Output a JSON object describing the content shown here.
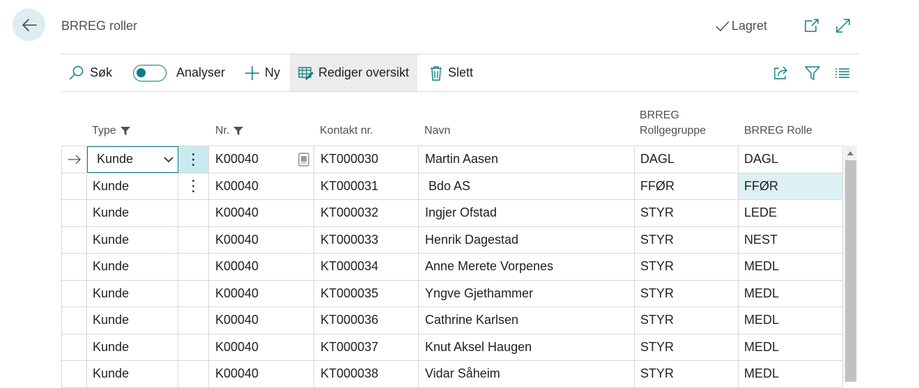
{
  "header": {
    "title": "BRREG roller",
    "saved_label": "Lagret"
  },
  "actions": {
    "search": "Søk",
    "analyze": "Analyser",
    "new": "Ny",
    "edit_list": "Rediger oversikt",
    "delete": "Slett"
  },
  "columns": {
    "type": "Type",
    "nr": "Nr.",
    "kontakt": "Kontakt nr.",
    "navn": "Navn",
    "grp_line1": "BRREG",
    "grp_line2": "Rollgegruppe",
    "rolle": "BRREG Rolle"
  },
  "rows": [
    {
      "type": "Kunde",
      "nr": "K00040",
      "kontakt": "KT000030",
      "navn": "Martin Aasen",
      "grp": "DAGL",
      "rolle": "DAGL"
    },
    {
      "type": "Kunde",
      "nr": "K00040",
      "kontakt": "KT000031",
      "navn": " Bdo AS",
      "grp": "FFØR",
      "rolle": "FFØR"
    },
    {
      "type": "Kunde",
      "nr": "K00040",
      "kontakt": "KT000032",
      "navn": "Ingjer Ofstad",
      "grp": "STYR",
      "rolle": "LEDE"
    },
    {
      "type": "Kunde",
      "nr": "K00040",
      "kontakt": "KT000033",
      "navn": "Henrik Dagestad",
      "grp": "STYR",
      "rolle": "NEST"
    },
    {
      "type": "Kunde",
      "nr": "K00040",
      "kontakt": "KT000034",
      "navn": "Anne Merete Vorpenes",
      "grp": "STYR",
      "rolle": "MEDL"
    },
    {
      "type": "Kunde",
      "nr": "K00040",
      "kontakt": "KT000035",
      "navn": "Yngve Gjethammer",
      "grp": "STYR",
      "rolle": "MEDL"
    },
    {
      "type": "Kunde",
      "nr": "K00040",
      "kontakt": "KT000036",
      "navn": "Cathrine Karlsen",
      "grp": "STYR",
      "rolle": "MEDL"
    },
    {
      "type": "Kunde",
      "nr": "K00040",
      "kontakt": "KT000037",
      "navn": "Knut Aksel Haugen",
      "grp": "STYR",
      "rolle": "MEDL"
    },
    {
      "type": "Kunde",
      "nr": "K00040",
      "kontakt": "KT000038",
      "navn": "Vidar Såheim",
      "grp": "STYR",
      "rolle": "MEDL"
    }
  ],
  "icons": {
    "back": "arrow-left-icon",
    "saved": "checkmark-icon",
    "open_new": "open-in-new-window-icon",
    "expand": "expand-icon",
    "search": "search-icon",
    "new": "plus-icon",
    "edit_list": "edit-list-icon",
    "delete": "trash-icon",
    "share": "share-icon",
    "filter": "filter-icon",
    "list_view": "list-view-icon"
  },
  "colors": {
    "accent": "#0a7d86",
    "selected_cell": "#ddf0f2",
    "back_button_bg": "#ddeef0"
  }
}
